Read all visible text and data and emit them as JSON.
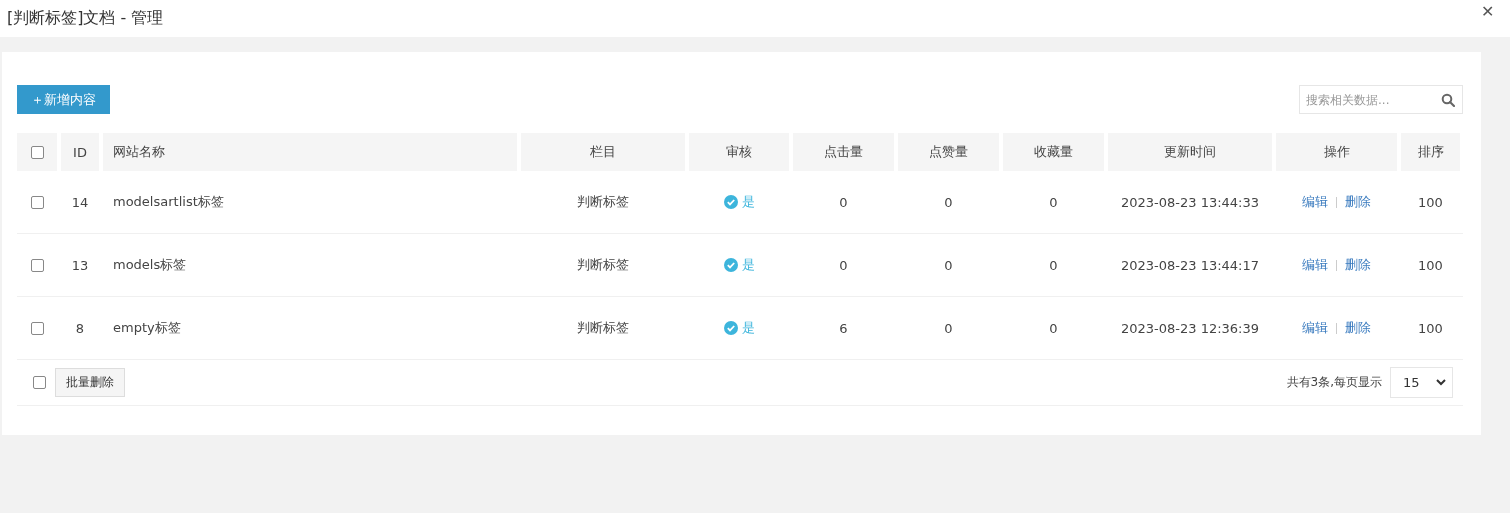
{
  "window": {
    "title": "[判断标签]文档 - 管理",
    "close": "✕"
  },
  "toolbar": {
    "add_button": "＋新增内容",
    "search": {
      "placeholder": "搜索相关数据..."
    }
  },
  "table": {
    "select_all": {
      "checked": false
    },
    "columns": [
      "ID",
      "网站名称",
      "栏目",
      "审核",
      "点击量",
      "点赞量",
      "收藏量",
      "更新时间",
      "操作",
      "排序"
    ],
    "rows": [
      {
        "checked": false,
        "id": "14",
        "name": "modelsartlist标签",
        "category": "判断标签",
        "audit": {
          "text": "是",
          "approved": true
        },
        "clicks": "0",
        "likes": "0",
        "favorites": "0",
        "updated": "2023-08-23 13:44:33",
        "actions": [
          "编辑",
          "删除"
        ],
        "order": "100"
      },
      {
        "checked": false,
        "id": "13",
        "name": "models标签",
        "category": "判断标签",
        "audit": {
          "text": "是",
          "approved": true
        },
        "clicks": "0",
        "likes": "0",
        "favorites": "0",
        "updated": "2023-08-23 13:44:17",
        "actions": [
          "编辑",
          "删除"
        ],
        "order": "100"
      },
      {
        "checked": false,
        "id": "8",
        "name": "empty标签",
        "category": "判断标签",
        "audit": {
          "text": "是",
          "approved": true
        },
        "clicks": "6",
        "likes": "0",
        "favorites": "0",
        "updated": "2023-08-23 12:36:39",
        "actions": [
          "编辑",
          "删除"
        ],
        "order": "100"
      }
    ]
  },
  "footer": {
    "select_all": {
      "checked": false
    },
    "batch_delete": "批量删除",
    "summary": "共有3条,每页显示",
    "per_page": "15"
  }
}
